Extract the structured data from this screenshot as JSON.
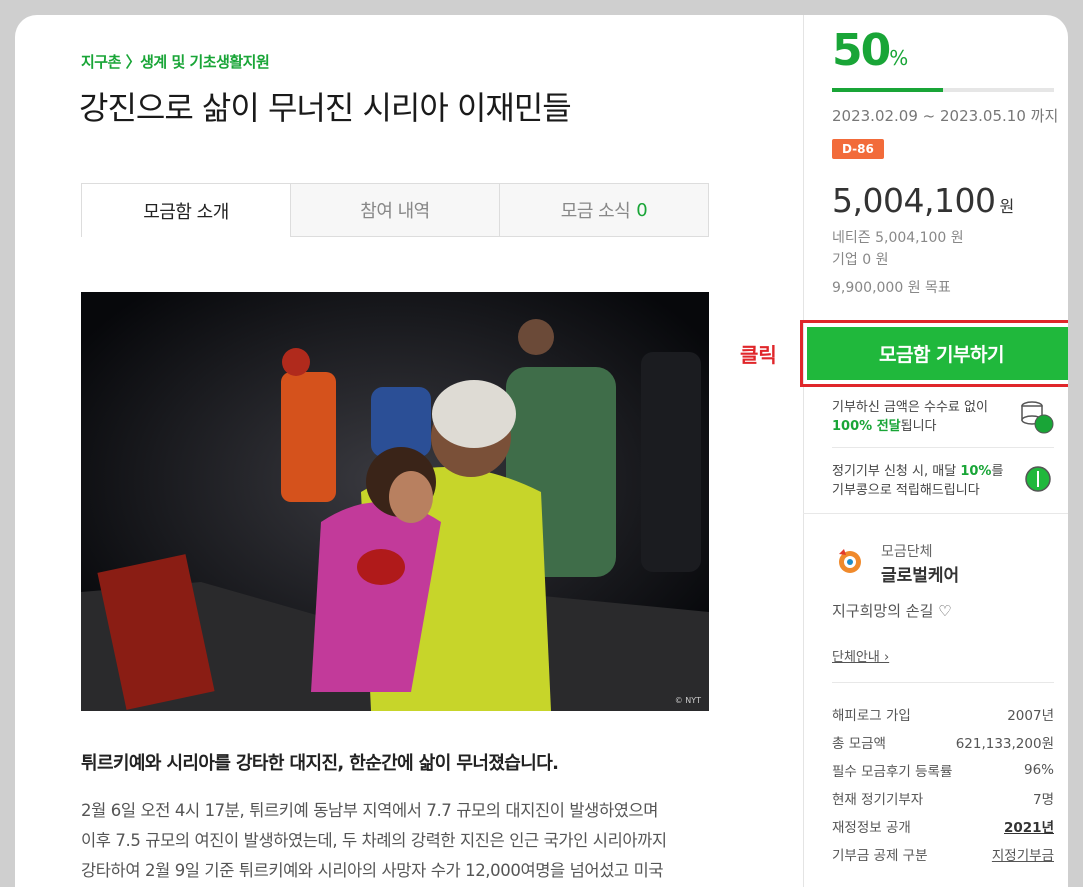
{
  "campaign": {
    "breadcrumb": "지구촌 〉생계 및 기초생활지원",
    "title": "강진으로 삶이 무너진 시리아 이재민들"
  },
  "tabs": [
    {
      "label": "모금함 소개"
    },
    {
      "label": "참여 내역"
    },
    {
      "label": "모금 소식",
      "count": "0"
    }
  ],
  "photo": {
    "credit": "© NYT"
  },
  "content": {
    "lead": "튀르키예와 시리아를 강타한 대지진, 한순간에 삶이 무너졌습니다.",
    "lines": [
      "2월 6일 오전 4시 17분, 튀르키예 동남부 지역에서 7.7 규모의 대지진이 발생하였으며",
      "이후 7.5 규모의 여진이 발생하였는데, 두 차례의 강력한 지진은 인근 국가인 시리아까지",
      "강타하여 2월 9일 기준 튀르키예와 시리아의 사망자 수가 12,000여명을 넘어섰고 미국"
    ]
  },
  "funding": {
    "percent": "50",
    "percent_unit": "%",
    "progress": 0.5,
    "period": "2023.02.09 ~ 2023.05.10",
    "period_suffix": "까지",
    "dday": "D-86",
    "amount": "5,004,100",
    "amount_unit": "원",
    "netizen": "네티즌 5,004,100 원",
    "company": "기업 0 원",
    "goal": "9,900,000 원 목표"
  },
  "donate": {
    "button_label": "모금함 기부하기",
    "click_annotation": "클릭"
  },
  "notices": {
    "fee_line1": "기부하신 금액은 수수료 없이",
    "fee_bold": "100% 전달",
    "fee_line2_rest": "됩니다",
    "regular_prefix": "정기기부 신청 시, 매달 ",
    "regular_bold": "10%",
    "regular_suffix": "를",
    "regular_line2": "기부콩으로 적립해드립니다"
  },
  "org": {
    "caption": "모금단체",
    "name": "글로벌케어",
    "slogan": "지구희망의 손길 ♡",
    "guide_link": "단체안내 ›"
  },
  "stats": [
    {
      "label": "해피로그 가입",
      "value": "2007년"
    },
    {
      "label": "총 모금액",
      "value": "621,133,200원"
    },
    {
      "label": "필수 모금후기 등록률",
      "value": "96%"
    },
    {
      "label": "현재 정기기부자",
      "value": "7명"
    },
    {
      "label": "재정정보 공개",
      "value": "2021년"
    },
    {
      "label": "기부금 공제 구분",
      "value": "지정기부금"
    }
  ],
  "colors": {
    "accent": "#19a537",
    "button": "#20b83c",
    "highlight": "#e0262a",
    "dday": "#f26b3a"
  }
}
